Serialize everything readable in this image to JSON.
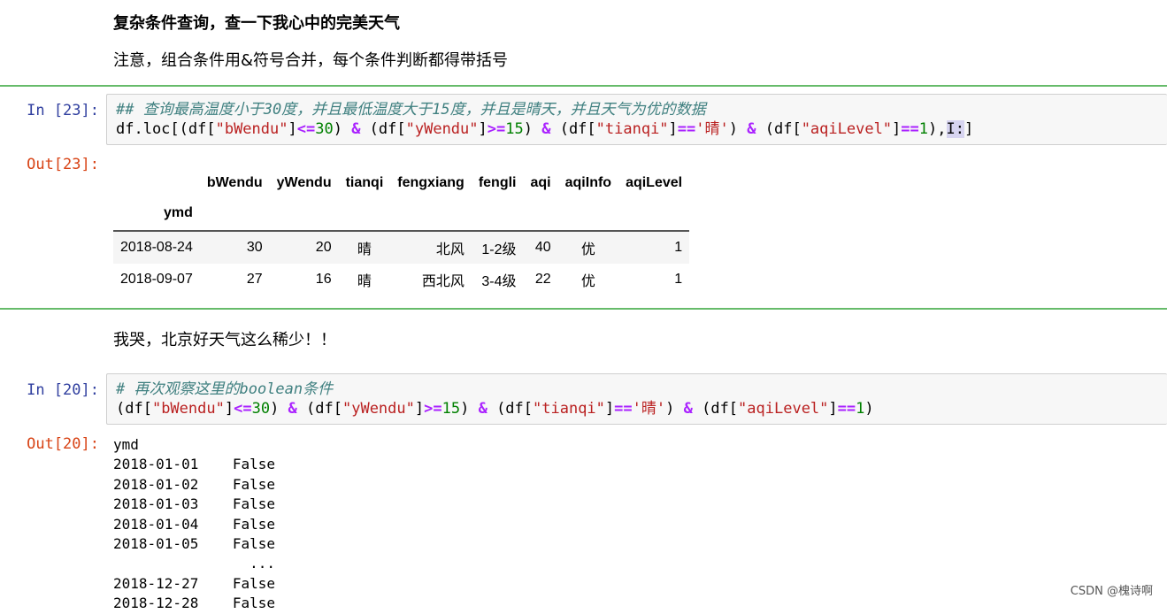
{
  "markdown": {
    "heading": "复杂条件查询，查一下我心中的完美天气",
    "note": "注意，组合条件用&符号合并，每个条件判断都得带括号",
    "comment": "我哭，北京好天气这么稀少！！"
  },
  "cell23": {
    "in_prompt": "In  [23]:",
    "out_prompt": "Out[23]:",
    "comment": "## 查询最高温度小于30度，并且最低温度大于15度，并且是晴天，并且天气为优的数据",
    "code": {
      "p1": "df.loc[(df[",
      "s1": "\"bWendu\"",
      "p2": "]",
      "o1": "<=",
      "n1": "30",
      "p3": ") ",
      "amp1": "&",
      "p4": " (df[",
      "s2": "\"yWendu\"",
      "p5": "]",
      "o2": ">=",
      "n2": "15",
      "p6": ") ",
      "amp2": "&",
      "p7": " (df[",
      "s3": "\"tianqi\"",
      "p8": "]",
      "o3": "==",
      "s4": "'晴'",
      "p9": ") ",
      "amp3": "&",
      "p10": " (df[",
      "s5": "\"aqiLevel\"",
      "p11": "]",
      "o4": "==",
      "n3": "1",
      "p12": "),",
      "sel": "I:",
      "p13": "]"
    },
    "table": {
      "columns": [
        "bWendu",
        "yWendu",
        "tianqi",
        "fengxiang",
        "fengli",
        "aqi",
        "aqiInfo",
        "aqiLevel"
      ],
      "index_name": "ymd",
      "rows": [
        {
          "idx": "2018-08-24",
          "bWendu": "30",
          "yWendu": "20",
          "tianqi": "晴",
          "fengxiang": "北风",
          "fengli": "1-2级",
          "aqi": "40",
          "aqiInfo": "优",
          "aqiLevel": "1"
        },
        {
          "idx": "2018-09-07",
          "bWendu": "27",
          "yWendu": "16",
          "tianqi": "晴",
          "fengxiang": "西北风",
          "fengli": "3-4级",
          "aqi": "22",
          "aqiInfo": "优",
          "aqiLevel": "1"
        }
      ]
    }
  },
  "cell20": {
    "in_prompt": "In  [20]:",
    "out_prompt": "Out[20]:",
    "comment": "# 再次观察这里的boolean条件",
    "code": {
      "p1": "(df[",
      "s1": "\"bWendu\"",
      "p2": "]",
      "o1": "<=",
      "n1": "30",
      "p3": ") ",
      "amp1": "&",
      "p4": " (df[",
      "s2": "\"yWendu\"",
      "p5": "]",
      "o2": ">=",
      "n2": "15",
      "p6": ") ",
      "amp2": "&",
      "p7": " (df[",
      "s3": "\"tianqi\"",
      "p8": "]",
      "o3": "==",
      "s4": "'晴'",
      "p9": ") ",
      "amp3": "&",
      "p10": " (df[",
      "s5": "\"aqiLevel\"",
      "p11": "]",
      "o4": "==",
      "n3": "1",
      "p12": ")"
    },
    "output_lines": [
      "ymd",
      "2018-01-01    False",
      "2018-01-02    False",
      "2018-01-03    False",
      "2018-01-04    False",
      "2018-01-05    False",
      "                ...",
      "2018-12-27    False",
      "2018-12-28    False"
    ]
  },
  "watermark": "CSDN @槐诗啊"
}
